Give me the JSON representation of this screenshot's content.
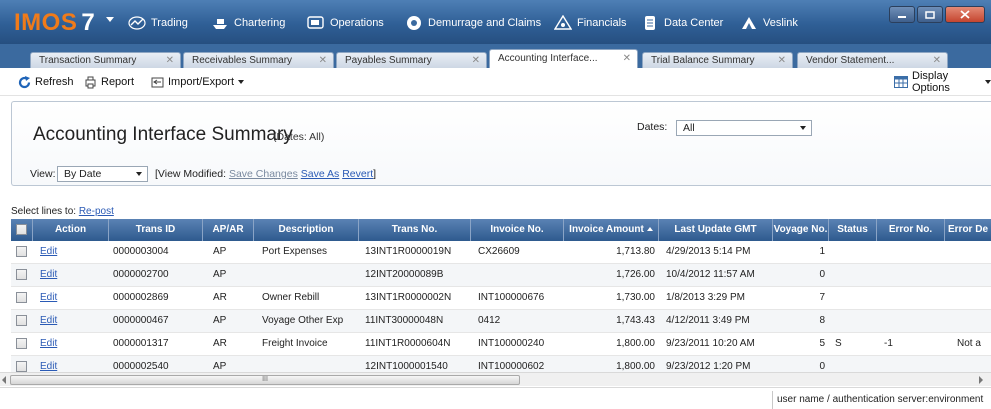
{
  "app": {
    "logo": "IMOS",
    "version": "7"
  },
  "nav": {
    "items": [
      {
        "label": "Trading",
        "icon": "trading-icon"
      },
      {
        "label": "Chartering",
        "icon": "chartering-icon"
      },
      {
        "label": "Operations",
        "icon": "operations-icon"
      },
      {
        "label": "Demurrage and Claims",
        "icon": "demurrage-icon"
      },
      {
        "label": "Financials",
        "icon": "financials-icon"
      },
      {
        "label": "Data Center",
        "icon": "data-center-icon"
      },
      {
        "label": "Veslink",
        "icon": "veslink-icon"
      }
    ]
  },
  "tabs": [
    {
      "label": "Transaction Summary",
      "active": false
    },
    {
      "label": "Receivables Summary",
      "active": false
    },
    {
      "label": "Payables Summary",
      "active": false
    },
    {
      "label": "Accounting Interface...",
      "active": true
    },
    {
      "label": "Trial Balance Summary",
      "active": false
    },
    {
      "label": "Vendor Statement...",
      "active": false
    }
  ],
  "toolbar": {
    "refresh": "Refresh",
    "report": "Report",
    "import_export": "Import/Export",
    "display_options": "Display Options"
  },
  "summary": {
    "title": "Accounting Interface Summary",
    "subtitle": "(Dates: All)",
    "dates_label": "Dates:",
    "dates_value": "All",
    "view_label": "View:",
    "view_value": "By Date",
    "view_modified_prefix": "[View Modified:",
    "save_changes": "Save Changes",
    "save_as": "Save As",
    "revert": "Revert",
    "close_bracket": "]"
  },
  "select_lines": {
    "prefix": "Select lines to:",
    "action": "Re-post"
  },
  "grid": {
    "columns": [
      "Action",
      "Trans ID",
      "AP/AR",
      "Description",
      "Trans No.",
      "Invoice No.",
      "Invoice Amount",
      "Last Update GMT",
      "Voyage No.",
      "Status",
      "Error No.",
      "Error De"
    ],
    "rows": [
      {
        "action": "Edit",
        "trans_id": "0000003004",
        "apar": "AP",
        "description": "Port Expenses",
        "trans_no": "13INT1R0000019N",
        "invoice_no": "CX26609",
        "amount": "1,713.80",
        "updated": "4/29/2013 5:14 PM",
        "voyage": "1",
        "status": "",
        "error_no": "",
        "error_desc": ""
      },
      {
        "action": "Edit",
        "trans_id": "0000002700",
        "apar": "AP",
        "description": "",
        "trans_no": "12INT20000089B",
        "invoice_no": "",
        "amount": "1,726.00",
        "updated": "10/4/2012 11:57 AM",
        "voyage": "0",
        "status": "",
        "error_no": "",
        "error_desc": ""
      },
      {
        "action": "Edit",
        "trans_id": "0000002869",
        "apar": "AR",
        "description": "Owner Rebill",
        "trans_no": "13INT1R0000002N",
        "invoice_no": "INT100000676",
        "amount": "1,730.00",
        "updated": "1/8/2013 3:29 PM",
        "voyage": "7",
        "status": "",
        "error_no": "",
        "error_desc": ""
      },
      {
        "action": "Edit",
        "trans_id": "0000000467",
        "apar": "AP",
        "description": "Voyage Other Exp",
        "trans_no": "11INT30000048N",
        "invoice_no": "0412",
        "amount": "1,743.43",
        "updated": "4/12/2011 3:49 PM",
        "voyage": "8",
        "status": "",
        "error_no": "",
        "error_desc": ""
      },
      {
        "action": "Edit",
        "trans_id": "0000001317",
        "apar": "AR",
        "description": "Freight Invoice",
        "trans_no": "11INT1R0000604N",
        "invoice_no": "INT100000240",
        "amount": "1,800.00",
        "updated": "9/23/2011 10:20 AM",
        "voyage": "5",
        "status": "S",
        "error_no": "-1",
        "error_desc": "Not a"
      },
      {
        "action": "Edit",
        "trans_id": "0000002540",
        "apar": "AP",
        "description": "",
        "trans_no": "12INT1000001540",
        "invoice_no": "INT100000602",
        "amount": "1,800.00",
        "updated": "9/23/2012 1:20 PM",
        "voyage": "0",
        "status": "",
        "error_no": "",
        "error_desc": ""
      }
    ]
  },
  "scrollbar": {
    "grip": "III"
  },
  "status": {
    "text": "user name / authentication server:environment"
  }
}
